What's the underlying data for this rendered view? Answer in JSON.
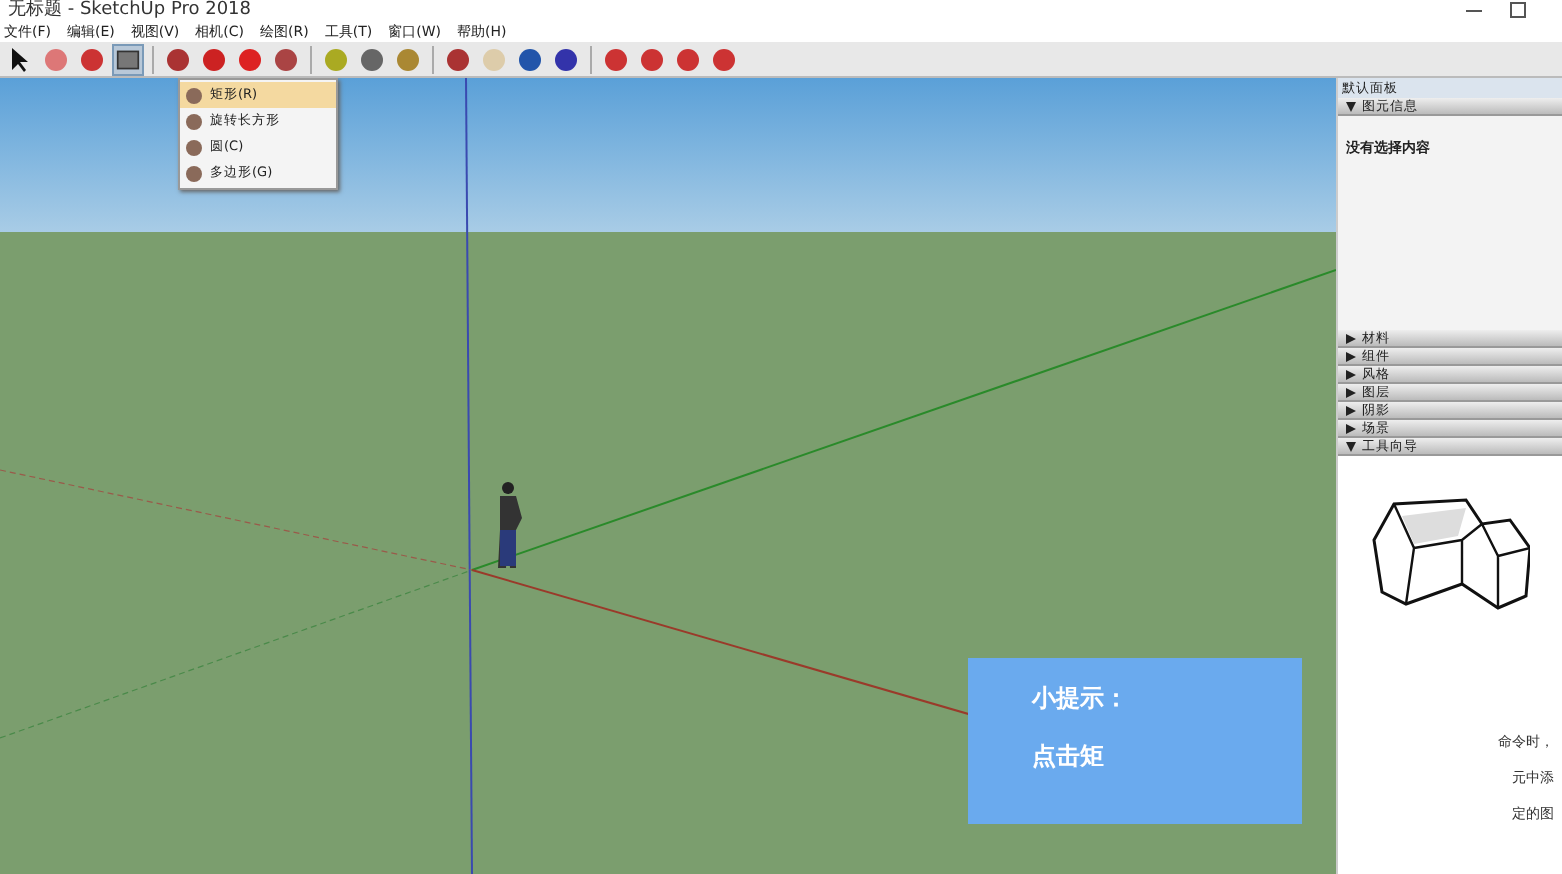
{
  "window": {
    "title": "无标题 - SketchUp Pro 2018"
  },
  "menu": [
    "文件(F)",
    "编辑(E)",
    "视图(V)",
    "相机(C)",
    "绘图(R)",
    "工具(T)",
    "窗口(W)",
    "帮助(H)"
  ],
  "toolbar": {
    "tools": [
      {
        "kind": "select",
        "selected": false
      },
      {
        "kind": "eraser",
        "selected": false
      },
      {
        "kind": "pencil",
        "selected": false
      },
      {
        "kind": "rect",
        "selected": true
      },
      {
        "kind": "push",
        "selected": false
      },
      {
        "kind": "move",
        "selected": false
      },
      {
        "kind": "rotate",
        "selected": false
      },
      {
        "kind": "scale",
        "selected": false
      },
      {
        "kind": "tape",
        "selected": false
      },
      {
        "kind": "text",
        "selected": false
      },
      {
        "kind": "paint",
        "selected": false
      },
      {
        "kind": "orbit",
        "selected": false
      },
      {
        "kind": "pan",
        "selected": false
      },
      {
        "kind": "zoom",
        "selected": false
      },
      {
        "kind": "extents",
        "selected": false
      },
      {
        "kind": "gem",
        "selected": false
      },
      {
        "kind": "gem",
        "selected": false
      },
      {
        "kind": "gem",
        "selected": false
      },
      {
        "kind": "gem",
        "selected": false
      }
    ]
  },
  "draw_menu": [
    {
      "label": "矩形(R)",
      "selected": true
    },
    {
      "label": "旋转长方形",
      "selected": false
    },
    {
      "label": "圆(C)",
      "selected": false
    },
    {
      "label": "多边形(G)",
      "selected": false
    }
  ],
  "tip": {
    "title": "小提示：",
    "body": "点击矩"
  },
  "panel": {
    "title": "默认面板",
    "entity_info": {
      "label": "图元信息",
      "expanded": true,
      "body": "没有选择内容"
    },
    "sections": [
      {
        "label": "材料",
        "expanded": false
      },
      {
        "label": "组件",
        "expanded": false
      },
      {
        "label": "风格",
        "expanded": false
      },
      {
        "label": "图层",
        "expanded": false
      },
      {
        "label": "阴影",
        "expanded": false
      },
      {
        "label": "场景",
        "expanded": false
      },
      {
        "label": "工具向导",
        "expanded": true
      }
    ],
    "instructor_lines": [
      "命令时，",
      "元中添",
      "定的图"
    ]
  }
}
